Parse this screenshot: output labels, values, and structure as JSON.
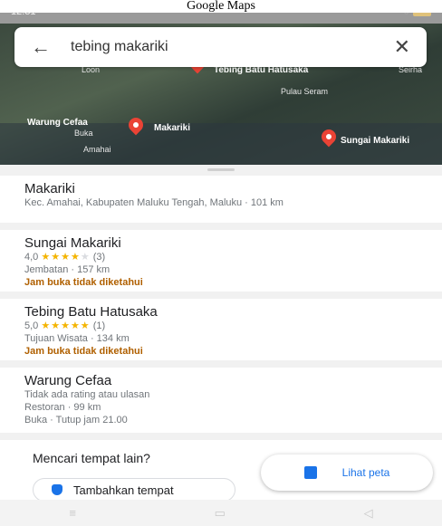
{
  "caption": "Google Maps",
  "status": {
    "time": "12.31"
  },
  "search": {
    "query": "tebing makariki"
  },
  "map": {
    "labels": [
      "Loon",
      "Tebing Batu Hatusaka",
      "Seirha",
      "Pulau Seram",
      "Warung Cefaa",
      "Buka",
      "Makariki",
      "Amahai",
      "Sungai Makariki"
    ]
  },
  "results": [
    {
      "name": "Makariki",
      "line1": "Kec. Amahai, Kabupaten Maluku Tengah, Maluku · 101 km"
    },
    {
      "name": "Sungai Makariki",
      "rating": "4,0",
      "stars_on": "★★★★",
      "stars_off": "★",
      "count": "(3)",
      "line1": "Jembatan · 157 km",
      "hours": "Jam buka tidak diketahui"
    },
    {
      "name": "Tebing Batu Hatusaka",
      "rating": "5,0",
      "stars_on": "★★★★★",
      "stars_off": "",
      "count": "(1)",
      "line1": "Tujuan Wisata · 134 km",
      "hours": "Jam buka tidak diketahui"
    },
    {
      "name": "Warung Cefaa",
      "line1": "Tidak ada rating atau ulasan",
      "line2": "Restoran · 99 km",
      "line3": "Buka · Tutup jam 21.00"
    }
  ],
  "footer": {
    "title": "Mencari tempat lain?",
    "add_label": "Tambahkan tempat",
    "map_label": "Lihat peta"
  },
  "nav": {
    "menu": "≡",
    "home": "▭",
    "back": "◁"
  }
}
